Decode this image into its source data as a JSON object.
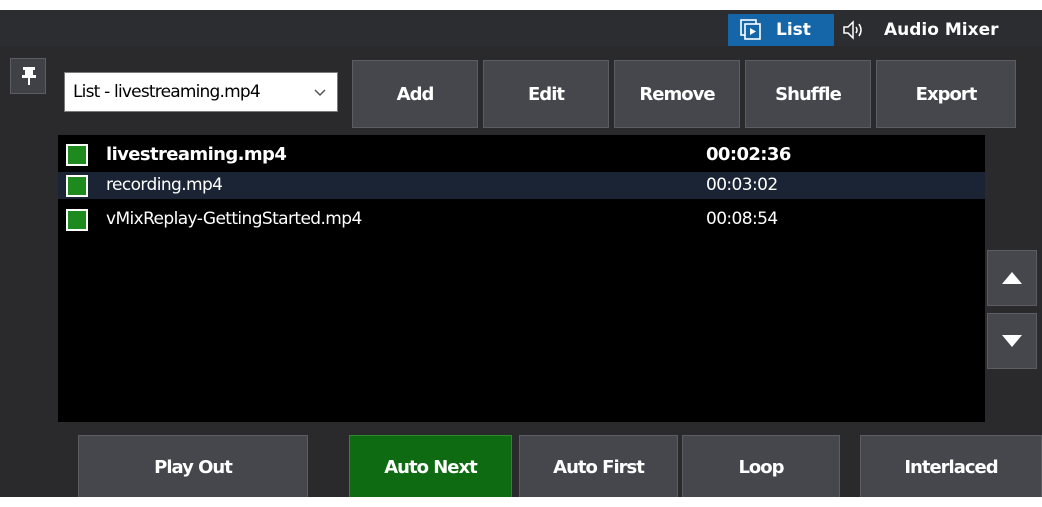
{
  "tabs": [
    {
      "label": "List",
      "icon": "play-list-icon",
      "active": true
    },
    {
      "label": "Audio Mixer",
      "icon": "speaker-icon",
      "active": false
    }
  ],
  "playlist_select": {
    "value": "List - livestreaming.mp4"
  },
  "toolbar": {
    "add_label": "Add",
    "edit_label": "Edit",
    "remove_label": "Remove",
    "shuffle_label": "Shuffle",
    "export_label": "Export"
  },
  "items": [
    {
      "name": "livestreaming.mp4",
      "duration": "00:02:36",
      "checked": true,
      "playing": true
    },
    {
      "name": "recording.mp4",
      "duration": "00:03:02",
      "checked": true,
      "selected": true
    },
    {
      "name": "vMixReplay-GettingStarted.mp4",
      "duration": "00:08:54",
      "checked": true
    }
  ],
  "footer": {
    "play_out_label": "Play Out",
    "auto_next_label": "Auto Next",
    "auto_first_label": "Auto First",
    "loop_label": "Loop",
    "interlaced_label": "Interlaced"
  },
  "colors": {
    "accent_tab": "#1566a8",
    "active_toggle": "#0f6b12",
    "check_green": "#1e8a1e"
  }
}
